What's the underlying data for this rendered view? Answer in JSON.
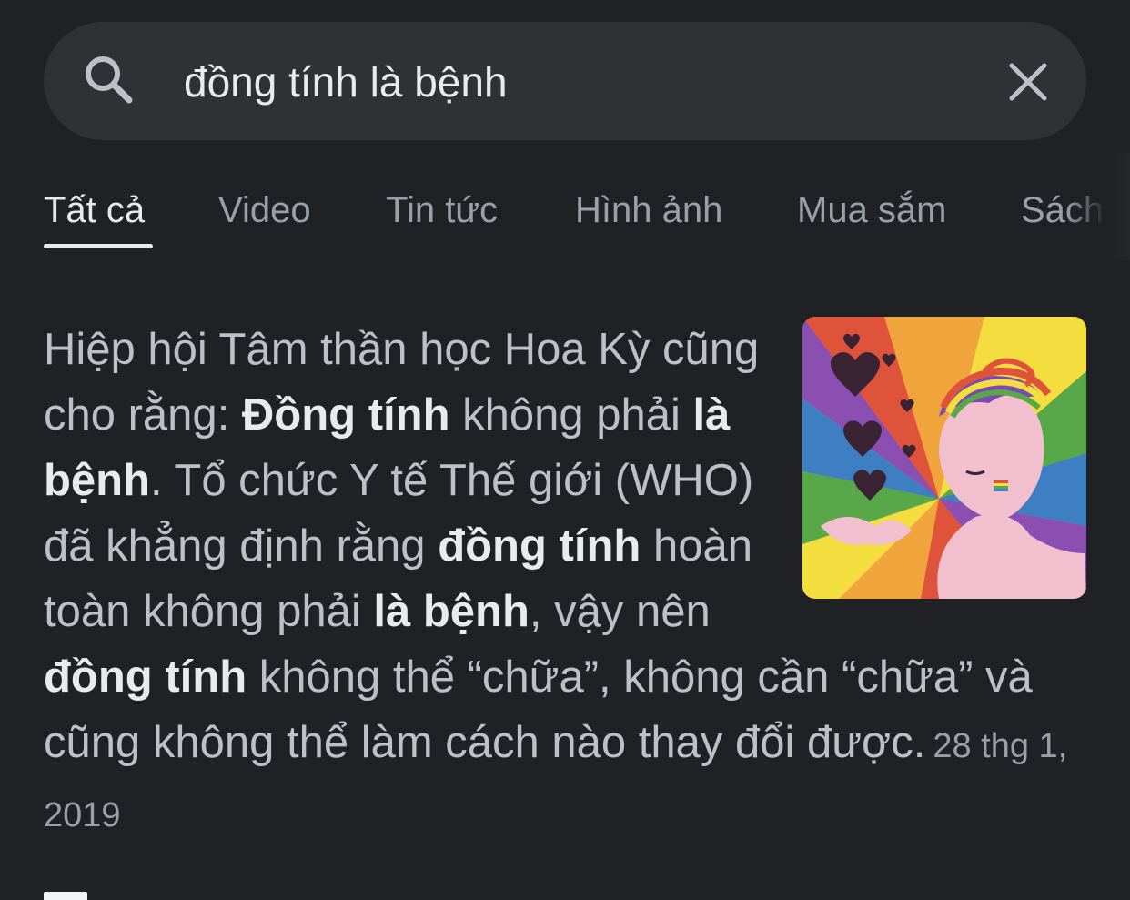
{
  "search": {
    "query": "đồng tính là bệnh",
    "search_icon": "search-icon",
    "clear_icon": "close-icon"
  },
  "tabs": [
    {
      "label": "Tất cả",
      "active": true
    },
    {
      "label": "Video",
      "active": false
    },
    {
      "label": "Tin tức",
      "active": false
    },
    {
      "label": "Hình ảnh",
      "active": false
    },
    {
      "label": "Mua sắm",
      "active": false
    },
    {
      "label": "Sách",
      "active": false
    }
  ],
  "snippet": {
    "segments": [
      {
        "text": "Hiệp hội Tâm thần học Hoa Kỳ cũng cho rằng: ",
        "bold": false
      },
      {
        "text": "Đồng tính",
        "bold": true
      },
      {
        "text": " không phải ",
        "bold": false
      },
      {
        "text": "là bệnh",
        "bold": true
      },
      {
        "text": ". Tổ chức Y tế Thế giới (WHO) đã khẳng định rằng ",
        "bold": false
      },
      {
        "text": "đồng tính",
        "bold": true
      },
      {
        "text": " hoàn toàn không phải ",
        "bold": false
      },
      {
        "text": "là bệnh",
        "bold": true
      },
      {
        "text": ", vậy nên ",
        "bold": false
      },
      {
        "text": "đồng tính",
        "bold": true
      },
      {
        "text": " không thể “chữa”, không cần “chữa” và cũng không thể làm cách nào thay đổi được.",
        "bold": false
      }
    ],
    "date": "28 thg 1, 2019",
    "image": "rainbow-pride-illustration"
  },
  "colors": {
    "background": "#202124",
    "search_bar": "#303134",
    "text_primary": "#e8eaed",
    "text_secondary": "#bdc1c6",
    "text_muted": "#9aa0a6"
  }
}
